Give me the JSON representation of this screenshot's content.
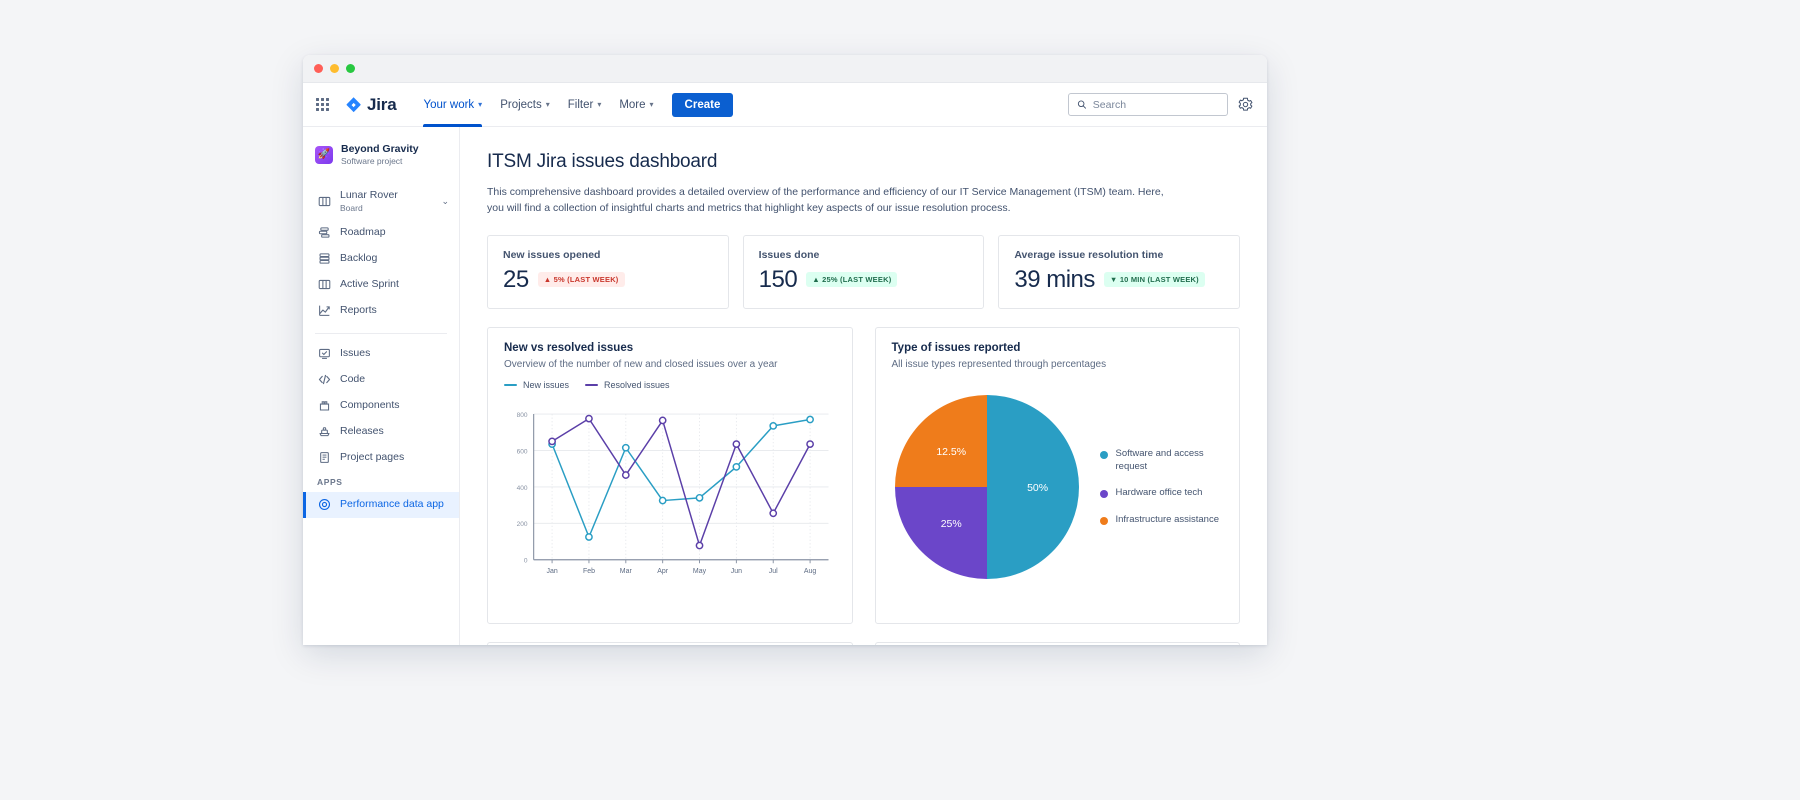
{
  "window": {
    "traffic_lights": [
      "close",
      "minimize",
      "maximize"
    ]
  },
  "topnav": {
    "app_switcher_icon": "grid-apps-icon",
    "brand": "Jira",
    "items": [
      {
        "label": "Your work",
        "has_caret": true,
        "active": true
      },
      {
        "label": "Projects",
        "has_caret": true,
        "active": false
      },
      {
        "label": "Filter",
        "has_caret": true,
        "active": false
      },
      {
        "label": "More",
        "has_caret": true,
        "active": false
      }
    ],
    "create_label": "Create",
    "search": {
      "placeholder": "Search",
      "value": "",
      "icon": "search-icon"
    },
    "settings_icon": "gear-icon"
  },
  "sidebar": {
    "project": {
      "name": "Beyond Gravity",
      "type": "Software project",
      "avatar_icon": "rocket-icon"
    },
    "items": [
      {
        "label": "Lunar Rover",
        "sub": "Board",
        "icon": "board-columns-icon",
        "chevron": true
      },
      {
        "label": "Roadmap",
        "icon": "roadmap-icon"
      },
      {
        "label": "Backlog",
        "icon": "backlog-icon"
      },
      {
        "label": "Active Sprint",
        "icon": "board-columns-icon"
      },
      {
        "label": "Reports",
        "icon": "reports-chart-icon"
      }
    ],
    "items2": [
      {
        "label": "Issues",
        "icon": "issues-icon"
      },
      {
        "label": "Code",
        "icon": "code-icon"
      },
      {
        "label": "Components",
        "icon": "components-icon"
      },
      {
        "label": "Releases",
        "icon": "releases-ship-icon"
      },
      {
        "label": "Project pages",
        "icon": "page-document-icon"
      }
    ],
    "apps_heading": "APPS",
    "apps": [
      {
        "label": "Performance data app",
        "icon": "target-circle-icon",
        "selected": true
      }
    ]
  },
  "main": {
    "title": "ITSM Jira issues dashboard",
    "description": "This comprehensive dashboard provides a detailed overview of the performance and efficiency of our IT Service Management (ITSM) team. Here, you will find a collection of insightful charts and metrics that highlight key aspects of our issue resolution process.",
    "stats": [
      {
        "label": "New issues opened",
        "value": "25",
        "badge": "5% (LAST WEEK)",
        "arrow": "▲",
        "trend": "up-bad"
      },
      {
        "label": "Issues done",
        "value": "150",
        "badge": "25% (LAST WEEK)",
        "arrow": "▲",
        "trend": "up-good"
      },
      {
        "label": "Average issue resolution time",
        "value": "39 mins",
        "badge": "10 MIN (LAST WEEK)",
        "arrow": "▼",
        "trend": "down-good"
      }
    ],
    "line_card": {
      "title": "New vs resolved issues",
      "subtitle": "Overview of the number of new and closed issues over a year"
    },
    "pie_card": {
      "title": "Type of issues reported",
      "subtitle": "All issue types represented through percentages"
    }
  },
  "colors": {
    "new_issues": "#2a9ec4",
    "resolved_issues": "#5b3fa8",
    "pie_software": "#2a9ec4",
    "pie_hardware": "#6b46c9",
    "pie_infra": "#ef7c1b",
    "accent_blue": "#0b5fd0"
  },
  "chart_data": [
    {
      "type": "line",
      "title": "New vs resolved issues",
      "subtitle": "Overview of the number of new and closed issues over a year",
      "categories": [
        "Jan",
        "Feb",
        "Mar",
        "Apr",
        "May",
        "Jun",
        "Jul",
        "Aug"
      ],
      "series": [
        {
          "name": "New issues",
          "color": "#2a9ec4",
          "values": [
            635,
            125,
            615,
            325,
            340,
            510,
            735,
            770
          ]
        },
        {
          "name": "Resolved issues",
          "color": "#5b3fa8",
          "values": [
            650,
            775,
            465,
            765,
            78,
            635,
            255,
            635
          ]
        }
      ],
      "xlabel": "",
      "ylabel": "",
      "ylim": [
        0,
        800
      ],
      "yticks": [
        0,
        200,
        400,
        600,
        800
      ],
      "grid": true,
      "legend_position": "top-left",
      "markers": "open-circle"
    },
    {
      "type": "pie",
      "title": "Type of issues reported",
      "subtitle": "All issue types represented through percentages",
      "labels": [
        "Software and access request",
        "Hardware office tech",
        "Infrastructure assistance"
      ],
      "values": [
        50,
        25,
        12.5
      ],
      "slice_labels": [
        "50%",
        "25%",
        "12.5%"
      ],
      "colors": [
        "#2a9ec4",
        "#6b46c9",
        "#ef7c1b"
      ],
      "legend_position": "right"
    }
  ]
}
